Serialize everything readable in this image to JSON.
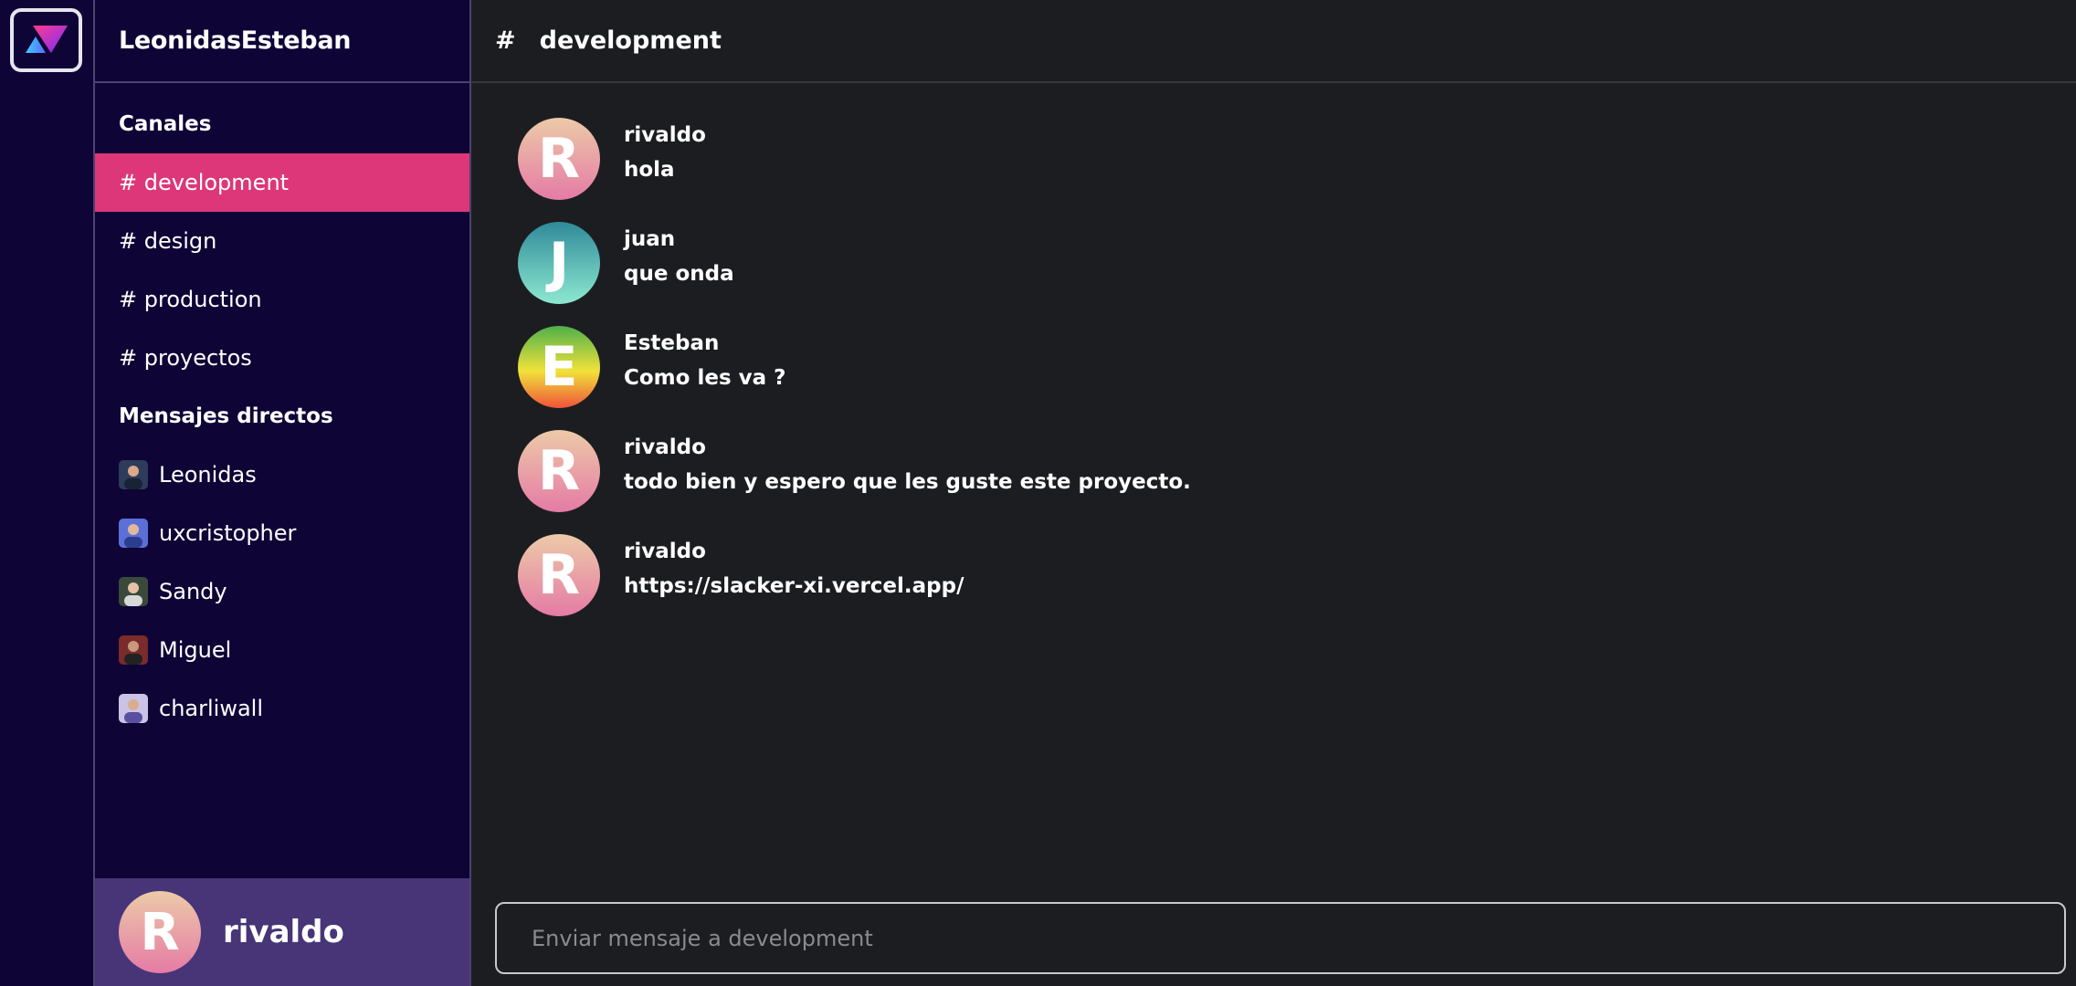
{
  "workspace": {
    "logo_icon": "triangle-logo-icon"
  },
  "sidebar": {
    "team_name": "LeonidasEsteban",
    "channels_title": "Canales",
    "channels": [
      {
        "label": "# development",
        "active": true
      },
      {
        "label": "# design",
        "active": false
      },
      {
        "label": "# production",
        "active": false
      },
      {
        "label": "# proyectos",
        "active": false
      }
    ],
    "dms_title": "Mensajes directos",
    "dms": [
      {
        "label": "Leonidas",
        "avatar_color": "#2e3b5c"
      },
      {
        "label": "uxcristopher",
        "avatar_color": "#5b6fd6"
      },
      {
        "label": "Sandy",
        "avatar_color": "#3a4a3a"
      },
      {
        "label": "Miguel",
        "avatar_color": "#7a2b2b"
      },
      {
        "label": "charliwall",
        "avatar_color": "#c9c3e6"
      }
    ],
    "profile": {
      "initial": "R",
      "name": "rivaldo"
    }
  },
  "main": {
    "hash": "#",
    "channel_name": "development",
    "messages": [
      {
        "initial": "R",
        "author": "rivaldo",
        "text": "hola",
        "gradient": [
          "#eccaa8",
          "#e57ba5"
        ]
      },
      {
        "initial": "J",
        "author": "juan",
        "text": "que onda",
        "gradient": [
          "#2f8a9a",
          "#8de8d0"
        ]
      },
      {
        "initial": "E",
        "author": "Esteban",
        "text": "Como les va ?",
        "gradient": [
          "#4fb04a",
          "#f1e23a",
          "#f0533a"
        ]
      },
      {
        "initial": "R",
        "author": "rivaldo",
        "text": "todo bien y espero que les guste este proyecto.",
        "gradient": [
          "#eccaa8",
          "#e57ba5"
        ]
      },
      {
        "initial": "R",
        "author": "rivaldo",
        "text": "https://slacker-xi.vercel.app/",
        "gradient": [
          "#eccaa8",
          "#e57ba5"
        ]
      }
    ],
    "composer": {
      "placeholder": "Enviar mensaje a development"
    }
  },
  "colors": {
    "sidebar_bg": "#0f0436",
    "active_channel": "#dd3679",
    "profile_bar": "#473578",
    "main_bg": "#1c1d21"
  }
}
